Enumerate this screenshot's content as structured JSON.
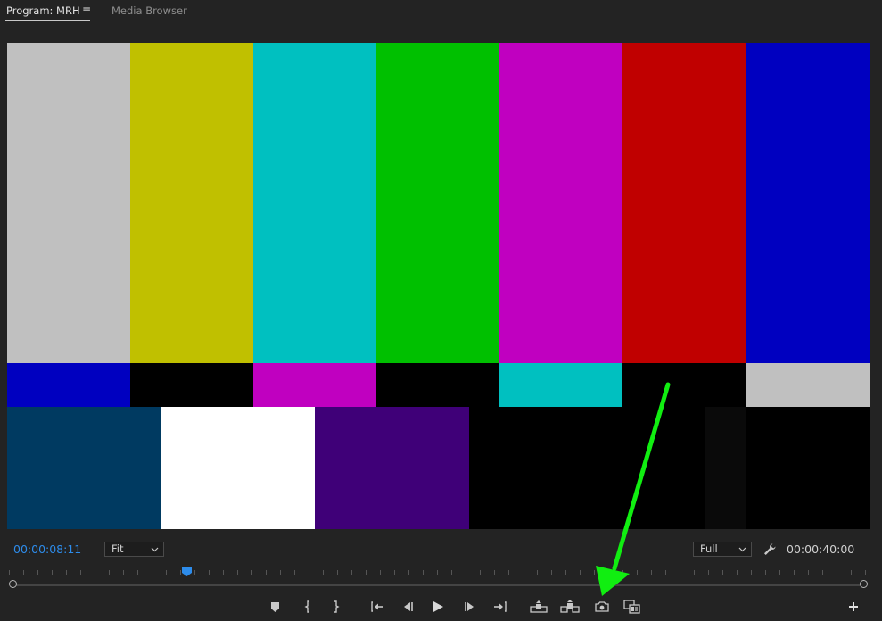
{
  "tabs": {
    "program_label": "Program: MRH",
    "program_menu_icon": "hamburger-menu-icon",
    "media_browser_label": "Media Browser"
  },
  "monitor": {
    "content": "smpte-color-bars",
    "colors": {
      "top": [
        "#c0c0c0",
        "#c0c000",
        "#00c0c0",
        "#00c000",
        "#c000c0",
        "#c00000",
        "#0000c0"
      ],
      "middle": [
        "#0000c0",
        "#000000",
        "#c000c0",
        "#000000",
        "#00c0c0",
        "#000000",
        "#c0c0c0"
      ],
      "bottom": [
        "#003a61",
        "#ffffff",
        "#3f0078",
        "#000000",
        "#0a0a0a",
        "#000000"
      ]
    }
  },
  "timecode": {
    "current": "00:00:08:11",
    "duration": "00:00:40:00"
  },
  "zoom_dropdown": {
    "selected": "Fit"
  },
  "resolution_dropdown": {
    "selected": "Full"
  },
  "settings_icon": "wrench-icon",
  "controls": [
    "add-marker-icon",
    "mark-in-icon",
    "mark-out-icon",
    "go-to-in-icon",
    "step-back-icon",
    "play-icon",
    "step-forward-icon",
    "go-to-out-icon",
    "lift-icon",
    "extract-icon",
    "export-frame-camera-icon",
    "comparison-view-icon",
    "button-editor-plus-icon"
  ],
  "annotation": {
    "arrow_color": "#11ee11"
  },
  "accent_color": "#2d8ceb"
}
